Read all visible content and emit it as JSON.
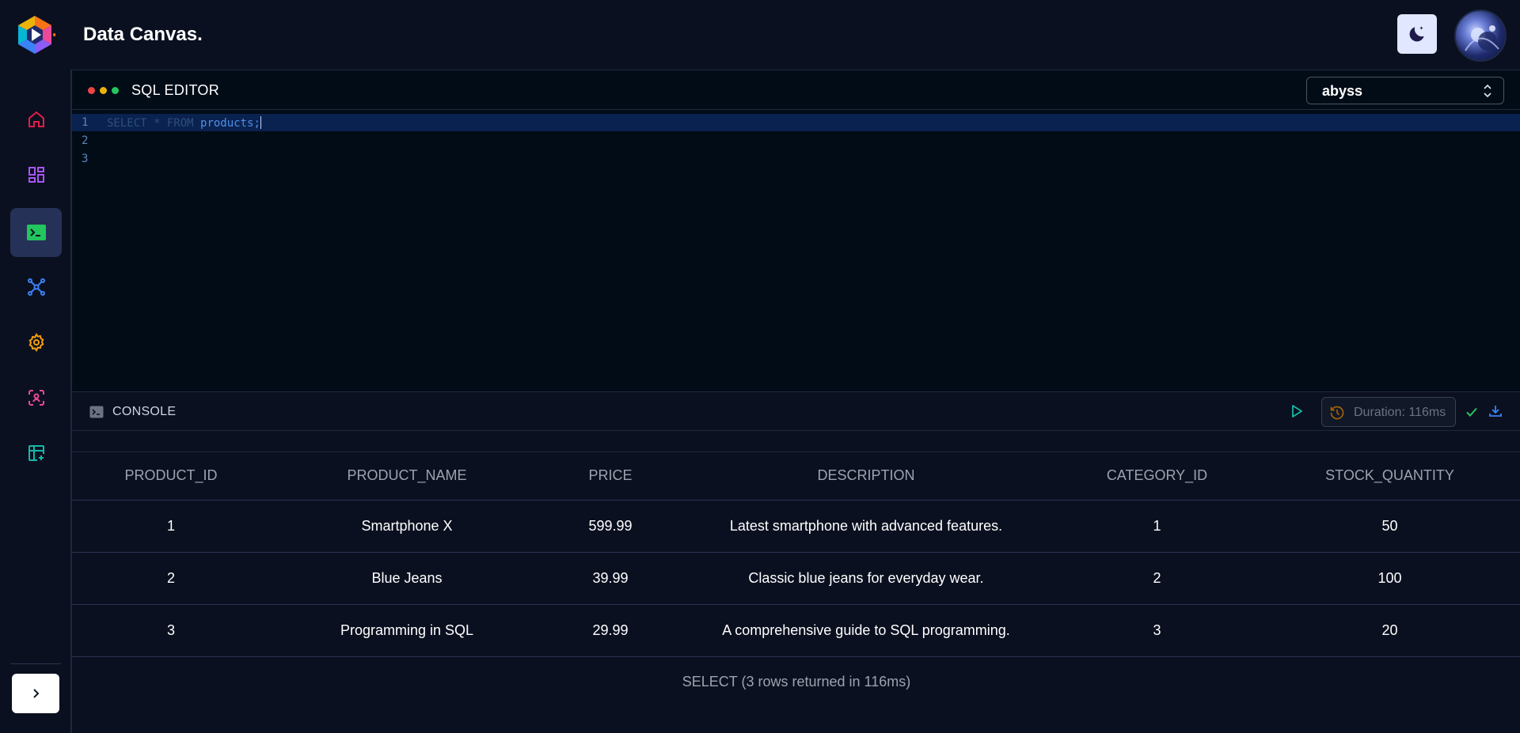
{
  "app": {
    "title": "Data Canvas."
  },
  "sidebar": {
    "items": [
      {
        "name": "home",
        "icon": "home-icon",
        "color": "#e11d48",
        "active": false
      },
      {
        "name": "dashboard",
        "icon": "dashboard-icon",
        "color": "#a855f7",
        "active": false
      },
      {
        "name": "sql-editor",
        "icon": "terminal-icon",
        "color": "#22c55e",
        "active": true
      },
      {
        "name": "schema",
        "icon": "network-icon",
        "color": "#3b82f6",
        "active": false
      },
      {
        "name": "settings",
        "icon": "gear-icon",
        "color": "#f59e0b",
        "active": false
      },
      {
        "name": "scan",
        "icon": "scan-face-icon",
        "color": "#ec4899",
        "active": false
      },
      {
        "name": "new-table",
        "icon": "table-plus-icon",
        "color": "#14b8a6",
        "active": false
      }
    ]
  },
  "editor": {
    "title": "SQL EDITOR",
    "database": "abyss",
    "lines": [
      {
        "number": "1",
        "keyword": "SELECT * FROM ",
        "identifier": "products",
        "tail": ";"
      },
      {
        "number": "2",
        "keyword": "",
        "identifier": "",
        "tail": ""
      },
      {
        "number": "3",
        "keyword": "",
        "identifier": "",
        "tail": ""
      }
    ]
  },
  "console": {
    "label": "CONSOLE",
    "duration": "Duration: 116ms"
  },
  "results": {
    "columns": [
      "PRODUCT_ID",
      "PRODUCT_NAME",
      "PRICE",
      "DESCRIPTION",
      "CATEGORY_ID",
      "STOCK_QUANTITY"
    ],
    "rows": [
      [
        "1",
        "Smartphone X",
        "599.99",
        "Latest smartphone with advanced features.",
        "1",
        "50"
      ],
      [
        "2",
        "Blue Jeans",
        "39.99",
        "Classic blue jeans for everyday wear.",
        "2",
        "100"
      ],
      [
        "3",
        "Programming in SQL",
        "29.99",
        "A comprehensive guide to SQL programming.",
        "3",
        "20"
      ]
    ],
    "status": "SELECT (3 rows returned in 116ms)"
  }
}
